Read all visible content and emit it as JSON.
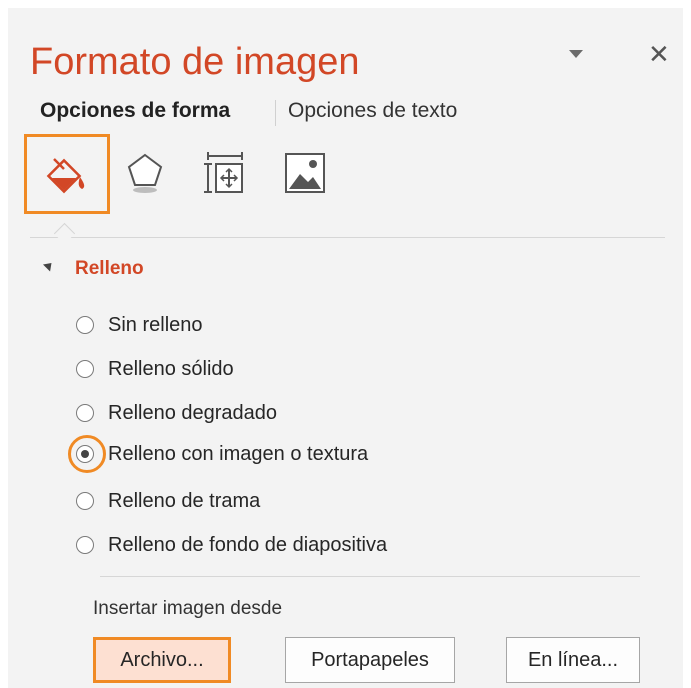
{
  "pane": {
    "title": "Formato de imagen",
    "dropdown_icon": "triangle-down-icon",
    "close_label": "✕"
  },
  "tabs": [
    {
      "label": "Opciones de forma",
      "active": true
    },
    {
      "label": "Opciones de texto",
      "active": false
    }
  ],
  "icon_tabs": [
    {
      "name": "fill-line-icon",
      "selected": true
    },
    {
      "name": "effects-icon",
      "selected": false
    },
    {
      "name": "size-properties-icon",
      "selected": false
    },
    {
      "name": "picture-icon",
      "selected": false
    }
  ],
  "section": {
    "title": "Relleno",
    "expanded": true
  },
  "fill_options": [
    {
      "label": "Sin relleno",
      "checked": false
    },
    {
      "label": "Relleno sólido",
      "checked": false
    },
    {
      "label": "Relleno degradado",
      "checked": false
    },
    {
      "label": "Relleno con imagen o textura",
      "checked": true
    },
    {
      "label": "Relleno de trama",
      "checked": false
    },
    {
      "label": "Relleno de fondo de diapositiva",
      "checked": false
    }
  ],
  "insert": {
    "label": "Insertar imagen desde",
    "buttons": [
      "Archivo...",
      "Portapapeles",
      "En línea..."
    ]
  },
  "colors": {
    "accent": "#d24726",
    "highlight": "#f08a24",
    "panel_bg": "#f3f3f3"
  }
}
